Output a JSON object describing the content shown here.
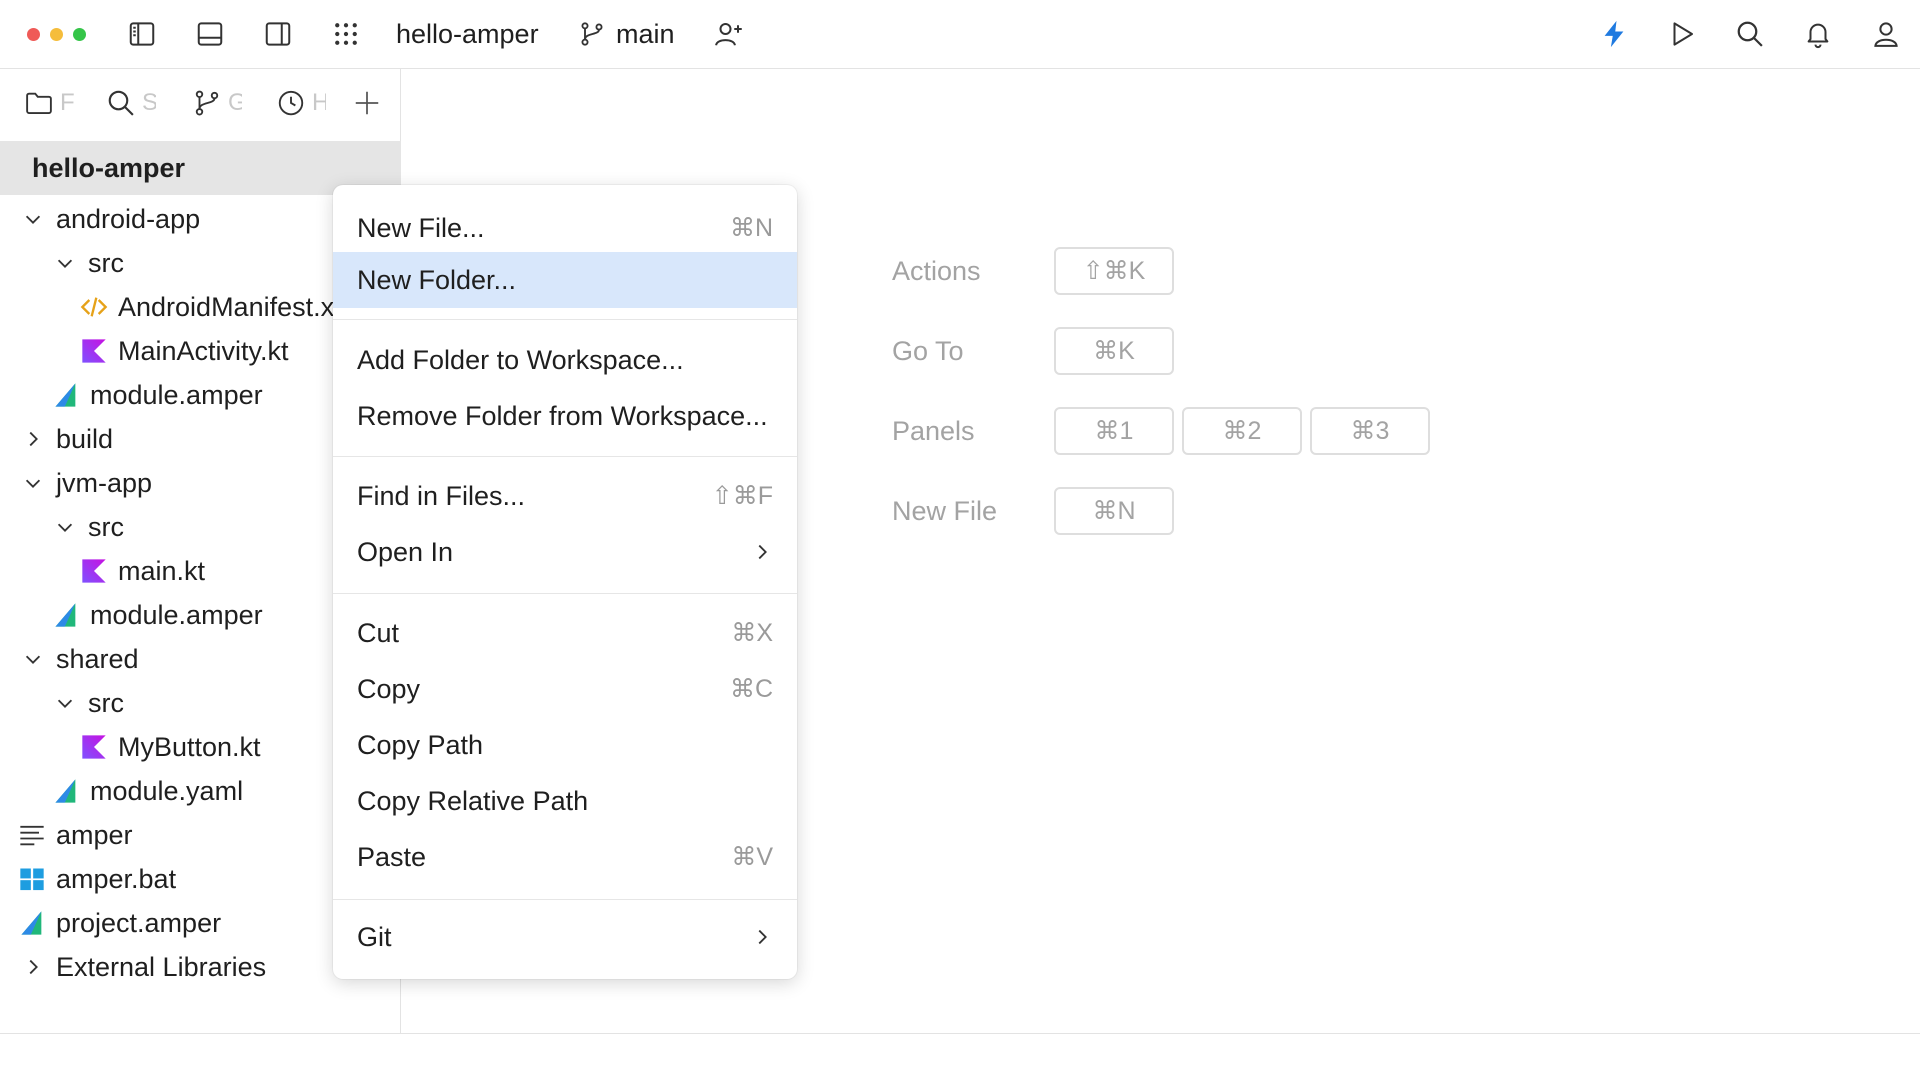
{
  "toolbar": {
    "project_name": "hello-amper",
    "branch": "main",
    "accent_color": "#1f7ae0"
  },
  "traffic_lights": {
    "close": "#ef5a57",
    "minimize": "#f5bd3b",
    "zoom": "#35c549"
  },
  "sidebar": {
    "tabs": [
      {
        "icon": "folder-icon",
        "label": "F"
      },
      {
        "icon": "search-icon",
        "label": "S"
      },
      {
        "icon": "git-branch-icon",
        "label": "G"
      },
      {
        "icon": "clock-icon",
        "label": "H"
      }
    ],
    "project_header": "hello-amper",
    "tree": [
      {
        "label": "android-app",
        "icon": "chevron-down-icon"
      },
      {
        "label": "src",
        "icon": "chevron-down-icon"
      },
      {
        "label": "AndroidManifest.xml",
        "icon": "xml-file-icon"
      },
      {
        "label": "MainActivity.kt",
        "icon": "kotlin-file-icon"
      },
      {
        "label": "module.amper",
        "icon": "amper-file-icon"
      },
      {
        "label": "build",
        "icon": "chevron-right-icon"
      },
      {
        "label": "jvm-app",
        "icon": "chevron-down-icon"
      },
      {
        "label": "src",
        "icon": "chevron-down-icon"
      },
      {
        "label": "main.kt",
        "icon": "kotlin-file-icon"
      },
      {
        "label": "module.amper",
        "icon": "amper-file-icon"
      },
      {
        "label": "shared",
        "icon": "chevron-down-icon"
      },
      {
        "label": "src",
        "icon": "chevron-down-icon"
      },
      {
        "label": "MyButton.kt",
        "icon": "kotlin-file-icon"
      },
      {
        "label": "module.yaml",
        "icon": "amper-file-icon"
      },
      {
        "label": "amper",
        "icon": "text-file-icon"
      },
      {
        "label": "amper.bat",
        "icon": "windows-file-icon"
      },
      {
        "label": "project.amper",
        "icon": "amper-file-icon"
      },
      {
        "label": "External Libraries",
        "icon": "chevron-right-icon"
      }
    ]
  },
  "context_menu": {
    "items": [
      {
        "label": "New File...",
        "shortcut": "⌘N"
      },
      {
        "label": "New Folder...",
        "shortcut": "",
        "highlighted": true
      },
      {
        "label": "Add Folder to Workspace...",
        "shortcut": ""
      },
      {
        "label": "Remove Folder from Workspace...",
        "shortcut": ""
      },
      {
        "label": "Find in Files...",
        "shortcut": "⇧⌘F"
      },
      {
        "label": "Open In",
        "shortcut": "",
        "submenu": true
      },
      {
        "label": "Cut",
        "shortcut": "⌘X"
      },
      {
        "label": "Copy",
        "shortcut": "⌘C"
      },
      {
        "label": "Copy Path",
        "shortcut": ""
      },
      {
        "label": "Copy Relative Path",
        "shortcut": ""
      },
      {
        "label": "Paste",
        "shortcut": "⌘V"
      },
      {
        "label": "Git",
        "shortcut": "",
        "submenu": true
      }
    ]
  },
  "welcome": {
    "rows": [
      {
        "label": "Actions",
        "keys": [
          "⇧⌘K"
        ]
      },
      {
        "label": "Go To",
        "keys": [
          "⌘K"
        ]
      },
      {
        "label": "Panels",
        "keys": [
          "⌘1",
          "⌘2",
          "⌘3"
        ]
      },
      {
        "label": "New File",
        "keys": [
          "⌘N"
        ]
      }
    ]
  }
}
